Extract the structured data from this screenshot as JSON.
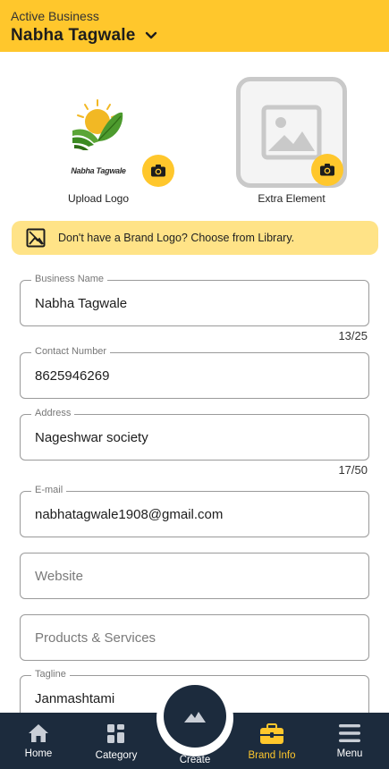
{
  "header": {
    "subtitle": "Active Business",
    "business_name": "Nabha Tagwale"
  },
  "logo": {
    "brand_text": "Nabha Tagwale",
    "upload_label": "Upload Logo",
    "extra_label": "Extra Element"
  },
  "banner": {
    "text": "Don't have a Brand Logo? Choose from Library."
  },
  "fields": {
    "business_name": {
      "label": "Business Name",
      "value": "Nabha Tagwale",
      "counter": "13/25"
    },
    "contact_number": {
      "label": "Contact Number",
      "value": "8625946269"
    },
    "address": {
      "label": "Address",
      "value": "Nageshwar society",
      "counter": "17/50"
    },
    "email": {
      "label": "E-mail",
      "value": "nabhatagwale1908@gmail.com"
    },
    "website": {
      "placeholder": "Website"
    },
    "products": {
      "placeholder": "Products & Services"
    },
    "tagline": {
      "label": "Tagline",
      "value": "Janmashtami"
    }
  },
  "nav": {
    "home": "Home",
    "category": "Category",
    "create": "Create",
    "brand_info": "Brand Info",
    "menu": "Menu"
  },
  "colors": {
    "accent": "#ffc72c",
    "banner": "#ffe387",
    "nav_bg": "#1c2b3d"
  }
}
